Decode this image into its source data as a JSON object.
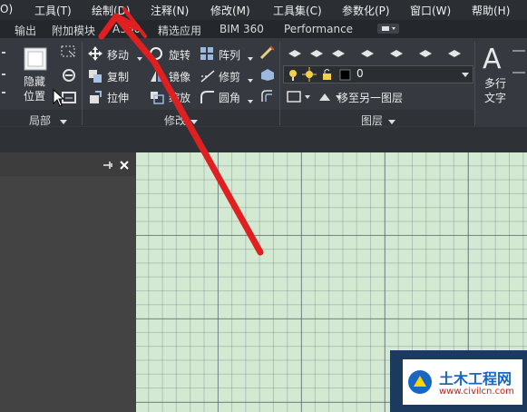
{
  "menu": {
    "items": [
      "O)",
      "工具(T)",
      "绘制(D)",
      "注释(N)",
      "修改(M)",
      "工具集(C)",
      "参数化(P)",
      "窗口(W)",
      "帮助(H)"
    ]
  },
  "tabs": {
    "items": [
      "输出",
      "附加模块",
      "A360",
      "精选应用",
      "BIM 360",
      "Performance"
    ]
  },
  "ribbon": {
    "layout_panel": {
      "hide_position_label": "隐藏\n位置",
      "panel_title": "局部"
    },
    "modify_panel": {
      "move": "移动",
      "rotate": "旋转",
      "array": "阵列",
      "copy": "复制",
      "mirror": "镜像",
      "trim": "修剪",
      "stretch": "拉伸",
      "scale": "缩放",
      "fillet": "圆角",
      "panel_title": "修改"
    },
    "layers_panel": {
      "current_layer": "0",
      "move_to_layer": "移至另一图层",
      "panel_title": "图层"
    },
    "annotation_panel": {
      "mtext_label": "多行\n文字"
    }
  },
  "watermark": {
    "title": "土木工程网",
    "url": "www.civilcn.com"
  },
  "colors": {
    "canvas_bg": "#d3e9d2",
    "arrow_red": "#e02020",
    "ribbon_bg": "#363a40"
  }
}
